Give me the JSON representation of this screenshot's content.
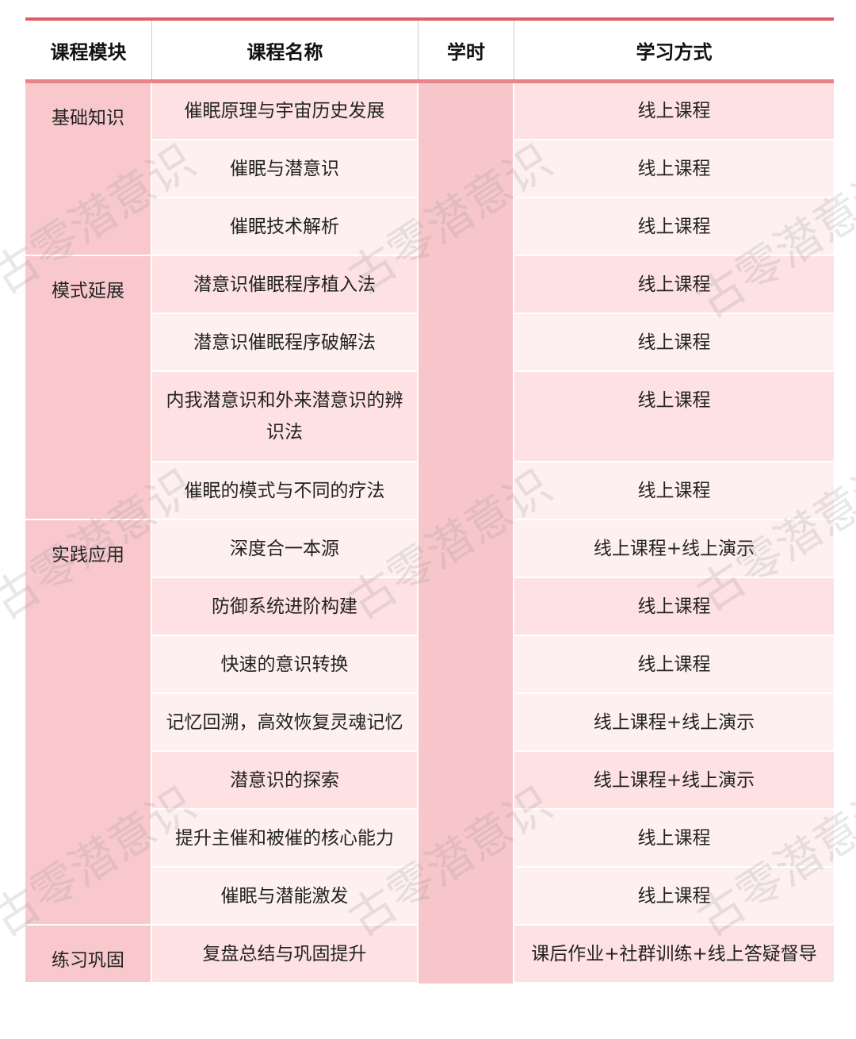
{
  "headers": [
    "课程模块",
    "课程名称",
    "学时",
    "学习方式"
  ],
  "modules": [
    {
      "name": "基础知识",
      "rows": 3
    },
    {
      "name": "模式延展",
      "rows": 4
    },
    {
      "name": "实践应用",
      "rows": 7
    },
    {
      "name": "练习巩固",
      "rows": 1
    }
  ],
  "rows": [
    {
      "course": "催眠原理与宇宙历史发展",
      "method": "线上课程"
    },
    {
      "course": "催眠与潜意识",
      "method": "线上课程"
    },
    {
      "course": "催眠技术解析",
      "method": "线上课程"
    },
    {
      "course": "潜意识催眠程序植入法",
      "method": "线上课程"
    },
    {
      "course": "潜意识催眠程序破解法",
      "method": "线上课程"
    },
    {
      "course": "内我潜意识和外来潜意识的辨识法",
      "method": "线上课程"
    },
    {
      "course": "催眠的模式与不同的疗法",
      "method": "线上课程"
    },
    {
      "course": "深度合一本源",
      "method": "线上课程+线上演示"
    },
    {
      "course": "防御系统进阶构建",
      "method": "线上课程"
    },
    {
      "course": "快速的意识转换",
      "method": "线上课程"
    },
    {
      "course": "记忆回溯，高效恢复灵魂记忆",
      "method": "线上课程+线上演示"
    },
    {
      "course": "潜意识的探索",
      "method": "线上课程+线上演示"
    },
    {
      "course": "提升主催和被催的核心能力",
      "method": "线上课程"
    },
    {
      "course": "催眠与潜能激发",
      "method": "线上课程"
    },
    {
      "course": "复盘总结与巩固提升",
      "method": "课后作业+社群训练+线上答疑督导"
    }
  ],
  "watermark": "古零潜意识",
  "colors": {
    "accent": "#e25b64",
    "module_bg": "#f8c8cd",
    "row_dark": "#fde1e3",
    "row_light": "#fef0f0"
  }
}
